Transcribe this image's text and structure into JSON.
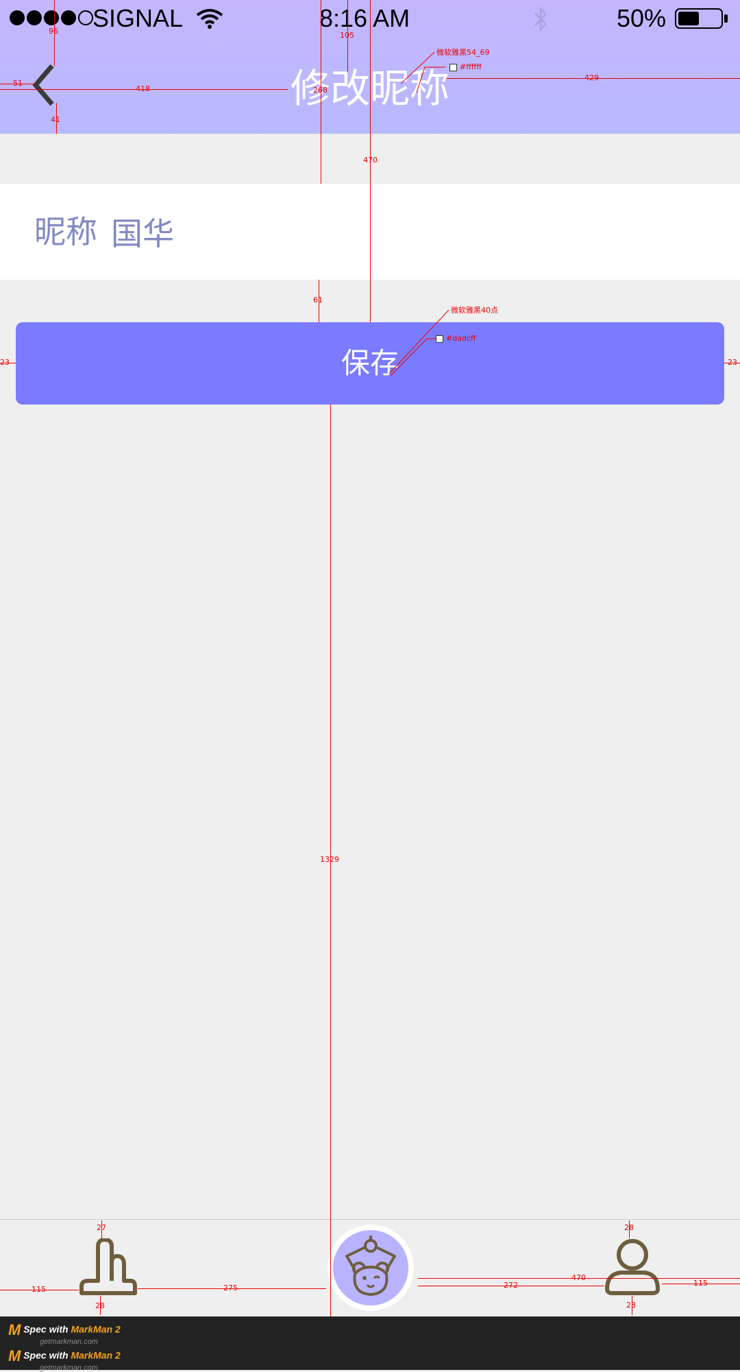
{
  "status_bar": {
    "carrier": "SIGNAL",
    "time": "8:16 AM",
    "battery": "50%",
    "battery_level": 0.5,
    "signal_bars": 4,
    "icons": [
      "wifi-icon",
      "bluetooth-icon",
      "battery-icon"
    ]
  },
  "header": {
    "title": "修改昵称",
    "back_icon": "chevron-left-icon"
  },
  "form": {
    "label": "昵称",
    "value": "国华"
  },
  "save_button": {
    "label": "保存"
  },
  "tab_bar": {
    "items": [
      {
        "icon": "hand-icon"
      },
      {
        "icon": "bear-mascot-icon"
      },
      {
        "icon": "person-icon"
      }
    ]
  },
  "annotations": {
    "title_font": "微软雅黑54_69",
    "title_color": "#ffffff",
    "button_font": "微软雅黑40点",
    "button_color": "#dadcff",
    "dims": [
      "96",
      "105",
      "51",
      "418",
      "268",
      "429",
      "41",
      "470",
      "61",
      "23",
      "23",
      "1329",
      "27",
      "28",
      "115",
      "275",
      "470",
      "272",
      "115",
      "28",
      "28"
    ]
  },
  "footer": {
    "promo_lines": [
      {
        "prefix": "Spec with ",
        "brand": "MarkMan 2",
        "site": "getmarkman.com"
      },
      {
        "prefix": "Spec with ",
        "brand": "MarkMan 2",
        "site": "getmarkman.com"
      }
    ]
  },
  "colors": {
    "header_top": "#c4b6ff",
    "header_bottom": "#b7b9ff",
    "button": "#7b7bff",
    "label": "#8289c4",
    "icon": "#6e5e3e",
    "background": "#efefef",
    "annotation": "#ee0000"
  }
}
